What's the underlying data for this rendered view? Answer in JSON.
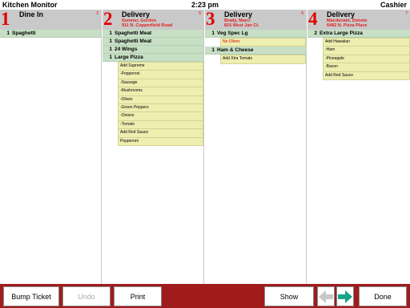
{
  "header": {
    "title": "Kitchen Monitor",
    "time": "2:23 pm",
    "user": "Cashier"
  },
  "tickets": [
    {
      "number": "1",
      "type": "Dine In",
      "line1": "",
      "line2": "",
      "badge": "2",
      "items": [
        {
          "kind": "item",
          "qty": "1",
          "name": "Spaghetti"
        }
      ]
    },
    {
      "number": "2",
      "type": "Delivery",
      "line1": "Sumner, Gordon",
      "line2": "911 N. Copperfield Road",
      "badge": "5",
      "items": [
        {
          "kind": "item",
          "qty": "1",
          "name": "Spaghetti Meat"
        },
        {
          "kind": "item",
          "qty": "1",
          "name": "Spaghetti Meat"
        },
        {
          "kind": "item",
          "qty": "1",
          "name": "24 Wings"
        },
        {
          "kind": "item",
          "qty": "1",
          "name": "Large Pizza"
        },
        {
          "kind": "mod",
          "name": "Add Supreme"
        },
        {
          "kind": "mod",
          "name": "-Pepperoni"
        },
        {
          "kind": "mod",
          "name": "-Sausage"
        },
        {
          "kind": "mod",
          "name": "-Mushrooms"
        },
        {
          "kind": "mod",
          "name": "-Olives"
        },
        {
          "kind": "mod",
          "name": "-Green Peppers"
        },
        {
          "kind": "mod",
          "name": "-Onions"
        },
        {
          "kind": "mod",
          "name": "-Tomato"
        },
        {
          "kind": "mod",
          "name": "Add Red Sauce"
        },
        {
          "kind": "mod",
          "name": "Pepperoni"
        }
      ]
    },
    {
      "number": "3",
      "type": "Delivery",
      "line1": "Brady, Marci",
      "line2": "815 West Jan Ct.",
      "badge": "6",
      "items": [
        {
          "kind": "item",
          "qty": "1",
          "name": "Veg Spec Lg"
        },
        {
          "kind": "mod",
          "name": "No Olives",
          "red": true
        },
        {
          "kind": "item",
          "qty": "1",
          "name": "Ham & Cheese"
        },
        {
          "kind": "mod",
          "name": "Add Xtra Tomato"
        }
      ]
    },
    {
      "number": "4",
      "type": "Delivery",
      "line1": "Macdonald, Donnie",
      "line2": "6482 N. Pizza Place",
      "badge": "7",
      "items": [
        {
          "kind": "item",
          "qty": "2",
          "name": "Extra Large Pizza"
        },
        {
          "kind": "mod",
          "name": "Add Hawaiian"
        },
        {
          "kind": "mod",
          "name": "-Ham"
        },
        {
          "kind": "mod",
          "name": "-Pineapple"
        },
        {
          "kind": "mod",
          "name": "-Bacon"
        },
        {
          "kind": "mod",
          "name": "Add Red Sauce"
        }
      ]
    }
  ],
  "footer": {
    "bump": "Bump Ticket",
    "undo": "Undo",
    "print": "Print",
    "show": "Show",
    "done": "Done",
    "prev_icon": "arrow-left-icon",
    "next_icon": "arrow-right-icon"
  },
  "colors": {
    "footer_bg": "#a01c1c",
    "ticket_number": "#e00000",
    "item_row": "#c7dfc5",
    "mod_row": "#eeeeb0",
    "next_arrow": "#1aa38a",
    "prev_arrow": "#c8c8c8"
  }
}
